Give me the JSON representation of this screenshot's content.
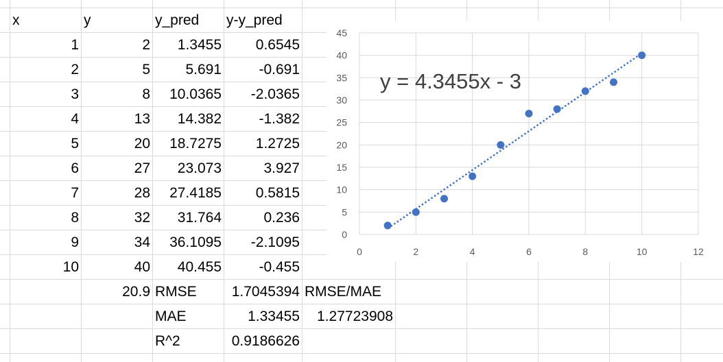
{
  "sheet": {
    "headers": {
      "x": "x",
      "y": "y",
      "y_pred": "y_pred",
      "resid": "y-y_pred"
    },
    "rows": [
      {
        "x": "1",
        "y": "2",
        "y_pred": "1.3455",
        "resid": "0.6545"
      },
      {
        "x": "2",
        "y": "5",
        "y_pred": "5.691",
        "resid": "-0.691"
      },
      {
        "x": "3",
        "y": "8",
        "y_pred": "10.0365",
        "resid": "-2.0365"
      },
      {
        "x": "4",
        "y": "13",
        "y_pred": "14.382",
        "resid": "-1.382"
      },
      {
        "x": "5",
        "y": "20",
        "y_pred": "18.7275",
        "resid": "1.2725"
      },
      {
        "x": "6",
        "y": "27",
        "y_pred": "23.073",
        "resid": "3.927"
      },
      {
        "x": "7",
        "y": "28",
        "y_pred": "27.4185",
        "resid": "0.5815"
      },
      {
        "x": "8",
        "y": "32",
        "y_pred": "31.764",
        "resid": "0.236"
      },
      {
        "x": "9",
        "y": "34",
        "y_pred": "36.1095",
        "resid": "-2.1095"
      },
      {
        "x": "10",
        "y": "40",
        "y_pred": "40.455",
        "resid": "-0.455"
      }
    ],
    "summary": {
      "mean_y": "20.9",
      "rmse_label": "RMSE",
      "rmse_value": "1.7045394",
      "ratio_label": "RMSE/MAE",
      "mae_label": "MAE",
      "mae_value": "1.33455",
      "ratio_value": "1.27723908",
      "r2_label": "R^2",
      "r2_value": "0.9186626"
    }
  },
  "chart_data": {
    "type": "scatter",
    "x": [
      1,
      2,
      3,
      4,
      5,
      6,
      7,
      8,
      9,
      10
    ],
    "y": [
      2,
      5,
      8,
      13,
      20,
      27,
      28,
      32,
      34,
      40
    ],
    "xlim": [
      0,
      12
    ],
    "ylim": [
      0,
      45
    ],
    "xticks": [
      "0",
      "2",
      "4",
      "6",
      "8",
      "10",
      "12"
    ],
    "yticks": [
      "0",
      "5",
      "10",
      "15",
      "20",
      "25",
      "30",
      "35",
      "40",
      "45"
    ],
    "trendline": {
      "slope": 4.3455,
      "intercept": -3,
      "style": "dotted"
    },
    "annotation": "y = 4.3455x - 3",
    "grid": true,
    "marker_color": "#4472c4"
  }
}
